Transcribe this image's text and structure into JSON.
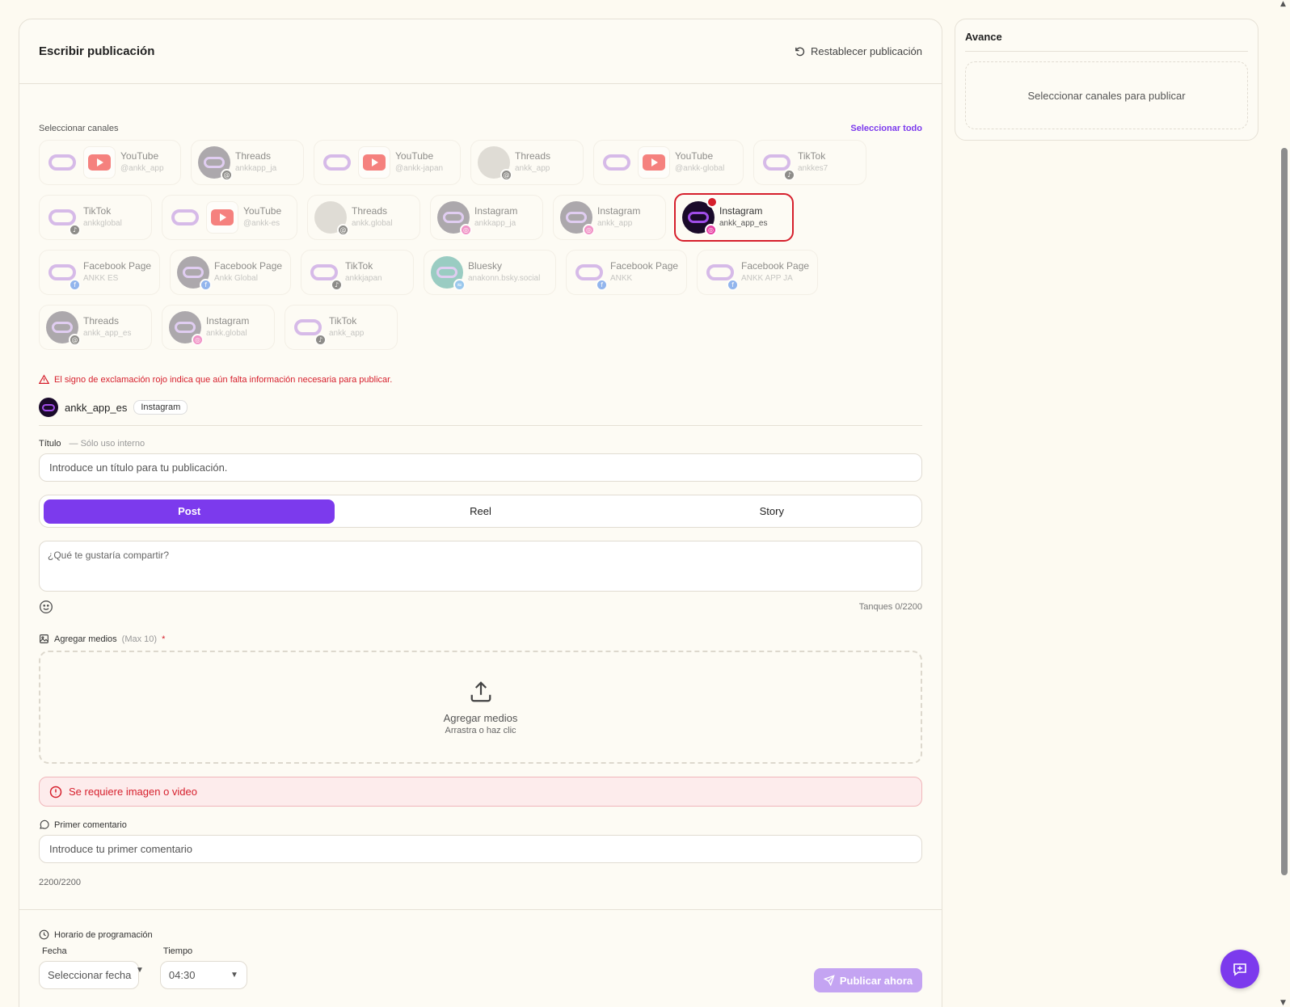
{
  "header": {
    "title": "Escribir publicación",
    "reset_label": "Restablecer publicación"
  },
  "channels_section": {
    "label": "Seleccionar canales",
    "select_all": "Seleccionar todo"
  },
  "channels": [
    {
      "platform": "YouTube",
      "handle": "@ankk_app",
      "logo": "brand-youtube"
    },
    {
      "platform": "Threads",
      "handle": "ankkapp_ja",
      "logo": "dark",
      "badge": "threads"
    },
    {
      "platform": "YouTube",
      "handle": "@ankk-japan",
      "logo": "brand-youtube"
    },
    {
      "platform": "Threads",
      "handle": "ankk_app",
      "logo": "photo",
      "badge": "threads"
    },
    {
      "platform": "YouTube",
      "handle": "@ankk-global",
      "logo": "brand-youtube"
    },
    {
      "platform": "TikTok",
      "handle": "ankkes7",
      "logo": "brand",
      "badge": "tiktok"
    },
    {
      "platform": "TikTok",
      "handle": "ankkglobal",
      "logo": "brand",
      "badge": "tiktok"
    },
    {
      "platform": "YouTube",
      "handle": "@ankk-es",
      "logo": "brand-youtube"
    },
    {
      "platform": "Threads",
      "handle": "ankk.global",
      "logo": "photo",
      "badge": "threads"
    },
    {
      "platform": "Instagram",
      "handle": "ankkapp_ja",
      "logo": "dark",
      "badge": "insta"
    },
    {
      "platform": "Instagram",
      "handle": "ankk_app",
      "logo": "dark",
      "badge": "insta"
    },
    {
      "platform": "Instagram",
      "handle": "ankk_app_es",
      "logo": "black",
      "badge": "insta",
      "selected": true
    },
    {
      "platform": "Facebook Page",
      "handle": "ANKK ES",
      "logo": "brand",
      "badge": "fb"
    },
    {
      "platform": "Facebook Page",
      "handle": "Ankk Global",
      "logo": "dark",
      "badge": "fb"
    },
    {
      "platform": "TikTok",
      "handle": "ankkjapan",
      "logo": "brand",
      "badge": "tiktok"
    },
    {
      "platform": "Bluesky",
      "handle": "anakonn.bsky.social",
      "logo": "teal",
      "badge": "bsky"
    },
    {
      "platform": "Facebook Page",
      "handle": "ANKK",
      "logo": "brand",
      "badge": "fb"
    },
    {
      "platform": "Facebook Page",
      "handle": "ANKK APP JA",
      "logo": "brand",
      "badge": "fb"
    },
    {
      "platform": "Threads",
      "handle": "ankk_app_es",
      "logo": "dark",
      "badge": "threads"
    },
    {
      "platform": "Instagram",
      "handle": "ankk.global",
      "logo": "dark",
      "badge": "insta"
    },
    {
      "platform": "TikTok",
      "handle": "ankk_app",
      "logo": "brand",
      "badge": "tiktok"
    }
  ],
  "warning": "El signo de exclamación rojo indica que aún falta información necesaria para publicar.",
  "account": {
    "name": "ankk_app_es",
    "platform_tag": "Instagram"
  },
  "title_field": {
    "label": "Título",
    "hint": "— Sólo uso interno",
    "placeholder": "Introduce un título para tu publicación."
  },
  "post_types": [
    "Post",
    "Reel",
    "Story"
  ],
  "active_post_type": "Post",
  "composer": {
    "placeholder": "¿Qué te gustaría compartir?",
    "counter": "Tanques 0/2200"
  },
  "media": {
    "label": "Agregar medios",
    "max": "(Max 10)",
    "required_mark": "*",
    "drop_title": "Agregar medios",
    "drop_sub": "Arrastra o haz clic"
  },
  "media_error": "Se requiere imagen o video",
  "first_comment": {
    "label": "Primer comentario",
    "placeholder": "Introduce tu primer comentario",
    "counter": "2200/2200"
  },
  "schedule": {
    "label": "Horario de programación",
    "date_label": "Fecha",
    "date_value": "Seleccionar fecha",
    "time_label": "Tiempo",
    "time_value": "04:30",
    "publish_label": "Publicar ahora"
  },
  "preview": {
    "title": "Avance",
    "empty": "Seleccionar canales para publicar"
  },
  "colors": {
    "accent": "#7c3aed",
    "error": "#d61f2c",
    "background": "#fdfaf1"
  }
}
